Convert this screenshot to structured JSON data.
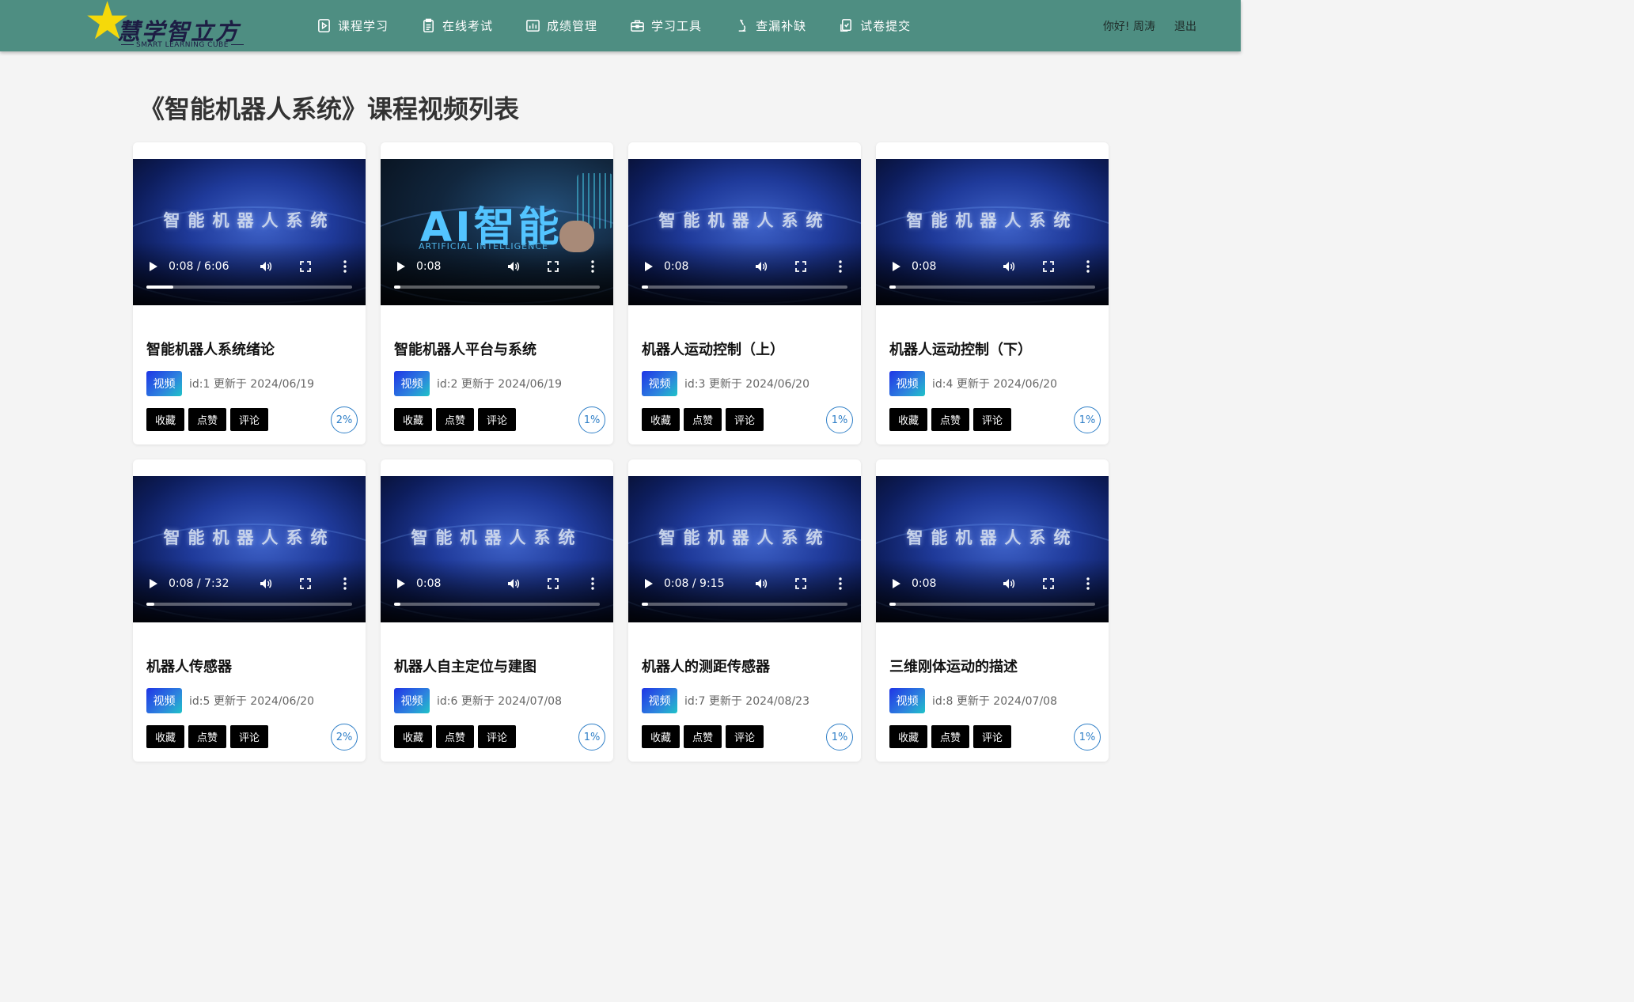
{
  "header": {
    "logo_text": "慧学智立方",
    "logo_subtext": "SMART LEARNING CUBE",
    "nav": [
      {
        "label": "课程学习",
        "icon": "play-doc-icon"
      },
      {
        "label": "在线考试",
        "icon": "clipboard-icon"
      },
      {
        "label": "成绩管理",
        "icon": "chart-icon"
      },
      {
        "label": "学习工具",
        "icon": "toolbox-icon"
      },
      {
        "label": "查漏补缺",
        "icon": "microscope-icon"
      },
      {
        "label": "试卷提交",
        "icon": "submit-doc-icon"
      }
    ],
    "greeting": "你好! 周涛",
    "logout": "退出"
  },
  "page_title": "《智能机器人系统》课程视频列表",
  "video_watermark": "智能机器人系统",
  "ai_cover": {
    "big": "AI智能",
    "sub": "ARTIFICIAL INTELLIGENCE"
  },
  "labels": {
    "tag": "视频",
    "favorite": "收藏",
    "like": "点赞",
    "comment": "评论"
  },
  "cards": [
    {
      "title": "智能机器人系统绪论",
      "meta": "id:1 更新于 2024/06/19",
      "time": "0:08 / 6:06",
      "progress": 0.13,
      "percent": "2%",
      "cover": "robot"
    },
    {
      "title": "智能机器人平台与系统",
      "meta": "id:2 更新于 2024/06/19",
      "time": "0:08",
      "progress": 0.03,
      "percent": "1%",
      "cover": "ai"
    },
    {
      "title": "机器人运动控制（上）",
      "meta": "id:3 更新于 2024/06/20",
      "time": "0:08",
      "progress": 0.03,
      "percent": "1%",
      "cover": "robot"
    },
    {
      "title": "机器人运动控制（下）",
      "meta": "id:4 更新于 2024/06/20",
      "time": "0:08",
      "progress": 0.03,
      "percent": "1%",
      "cover": "robot"
    },
    {
      "title": "机器人传感器",
      "meta": "id:5 更新于 2024/06/20",
      "time": "0:08 / 7:32",
      "progress": 0.04,
      "percent": "2%",
      "cover": "robot"
    },
    {
      "title": "机器人自主定位与建图",
      "meta": "id:6 更新于 2024/07/08",
      "time": "0:08",
      "progress": 0.03,
      "percent": "1%",
      "cover": "robot"
    },
    {
      "title": "机器人的测距传感器",
      "meta": "id:7 更新于 2024/08/23",
      "time": "0:08 / 9:15",
      "progress": 0.03,
      "percent": "1%",
      "cover": "robot"
    },
    {
      "title": "三维刚体运动的描述",
      "meta": "id:8 更新于 2024/07/08",
      "time": "0:08",
      "progress": 0.03,
      "percent": "1%",
      "cover": "robot"
    }
  ]
}
